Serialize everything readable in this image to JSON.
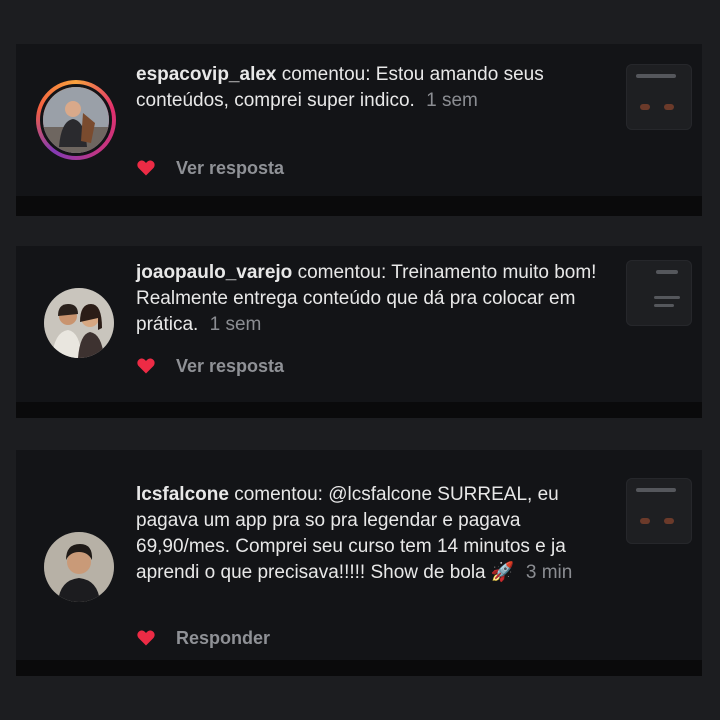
{
  "comments": [
    {
      "username": "espacovip_alex",
      "verb": "comentou:",
      "text": "Estou amando seus conteúdos, comprei super indico.",
      "time": "1 sem",
      "action": "Ver resposta",
      "avatar_icon": "user-avatar"
    },
    {
      "username": "joaopaulo_varejo",
      "verb": "comentou:",
      "text": "Treinamento muito bom! Realmente entrega conteúdo que dá pra colocar em prática.",
      "time": "1 sem",
      "action": "Ver resposta",
      "avatar_icon": "user-avatar"
    },
    {
      "username": "lcsfalcone",
      "verb": "comentou:",
      "text": "@lcsfalcone SURREAL, eu pagava um app pra so pra legendar e pagava 69,90/mes. Comprei seu curso tem 14 minutos e ja aprendi o que precisava!!!!! Show de bola 🚀",
      "time": "3 min",
      "action": "Responder",
      "avatar_icon": "user-avatar"
    }
  ],
  "colors": {
    "background": "#1c1d20",
    "card": "#131417",
    "heart": "#ed2b45",
    "muted": "#8b8d92"
  }
}
